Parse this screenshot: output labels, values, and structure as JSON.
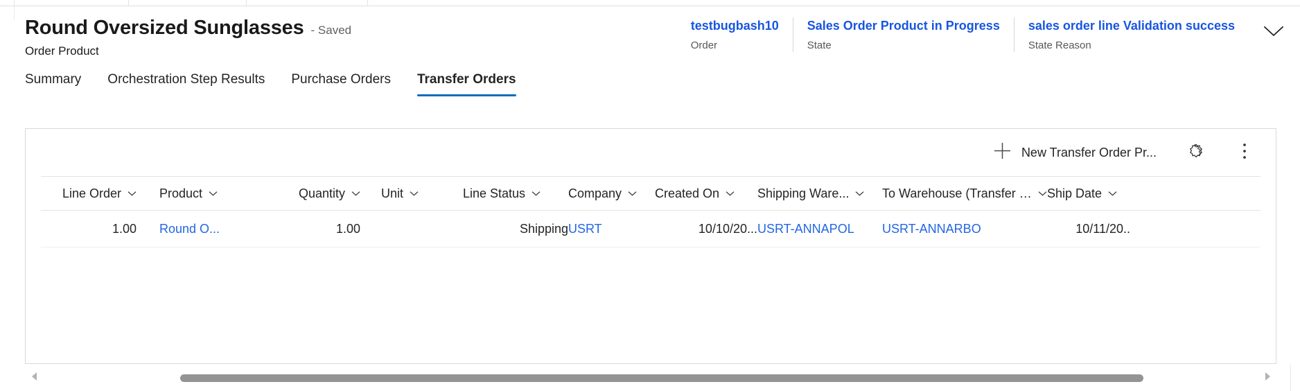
{
  "record": {
    "title": "Round Oversized Sunglasses",
    "saved_state": "- Saved",
    "entity_name": "Order Product"
  },
  "header_fields": [
    {
      "value": "testbugbash10",
      "label": "Order"
    },
    {
      "value": "Sales Order Product in Progress",
      "label": "State"
    },
    {
      "value": "sales order line Validation success",
      "label": "State Reason"
    }
  ],
  "header_expand_icon": "chevron-down-icon",
  "tabs": [
    {
      "label": "Summary",
      "active": false
    },
    {
      "label": "Orchestration Step Results",
      "active": false
    },
    {
      "label": "Purchase Orders",
      "active": false
    },
    {
      "label": "Transfer Orders",
      "active": true
    }
  ],
  "grid": {
    "toolbar": {
      "new_label": "New Transfer Order Pr...",
      "new_icon": "plus-icon",
      "flow_icon": "flow-icon",
      "more_icon": "more-vertical-icon"
    },
    "columns": [
      {
        "label": "Line Order"
      },
      {
        "label": "Product"
      },
      {
        "label": "Quantity"
      },
      {
        "label": "Unit"
      },
      {
        "label": "Line Status"
      },
      {
        "label": "Company"
      },
      {
        "label": "Created On"
      },
      {
        "label": "Shipping Ware..."
      },
      {
        "label": "To Warehouse (Transfer Or..."
      },
      {
        "label": "Ship Date"
      }
    ],
    "rows": [
      {
        "line_order": "1.00",
        "product": "Round O...",
        "quantity": "1.00",
        "unit": "",
        "line_status": "Shipping",
        "company": "USRT",
        "created_on": "10/10/20...",
        "shipping_warehouse": "USRT-ANNAPOL",
        "to_warehouse": "USRT-ANNARBO",
        "ship_date": "10/11/20.."
      }
    ],
    "scrollbar": {
      "left_arrow_icon": "caret-left-icon",
      "right_arrow_icon": "caret-right-icon"
    }
  },
  "colors": {
    "link": "#2266e3",
    "header_link": "#1756e0",
    "tab_underline": "#0f6cbd",
    "text": "#242424",
    "muted": "#616161",
    "scrollbar_thumb": "#949494"
  }
}
